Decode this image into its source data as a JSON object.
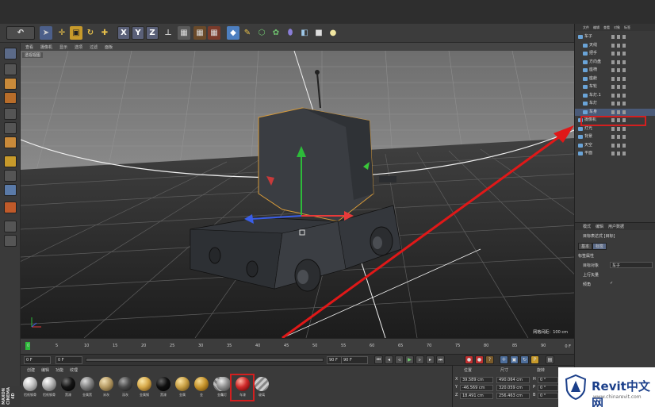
{
  "viewport": {
    "menu": [
      "查看",
      "摄像机",
      "显示",
      "选项",
      "过滤",
      "面板"
    ],
    "title": "透视视图",
    "grid_scale": "网格间距：100 cm"
  },
  "timeline": {
    "ticks": [
      "0",
      "5",
      "10",
      "15",
      "20",
      "25",
      "30",
      "35",
      "40",
      "45",
      "50",
      "55",
      "60",
      "65",
      "70",
      "75",
      "80",
      "85",
      "90"
    ],
    "frame_end": "0 F"
  },
  "playbar": {
    "start_field": "0 F",
    "current_field": "0 F",
    "end_field": "90 F",
    "end_field2": "90 F"
  },
  "materials": {
    "menu": [
      "创建",
      "编辑",
      "功能",
      "纹理"
    ],
    "items": [
      {
        "name": "铝纸钢骨",
        "color": "#c8c8c8"
      },
      {
        "name": "铝纸钢骨",
        "color": "#b9b9b9"
      },
      {
        "name": "黑漆",
        "color": "#141414"
      },
      {
        "name": "金属黑",
        "color": "#8a8a8a"
      },
      {
        "name": "米灰",
        "color": "#b59a64"
      },
      {
        "name": "深灰",
        "color": "#4a4a4a"
      },
      {
        "name": "金属钢",
        "color": "#d7a94a"
      },
      {
        "name": "黑漆",
        "color": "#0f0f0f"
      },
      {
        "name": "金属",
        "color": "#c9a045"
      },
      {
        "name": "金",
        "color": "#c7952d"
      },
      {
        "name": "金属",
        "color": "#9b9b9b"
      },
      {
        "name": "车灯",
        "color": "#8e8e8e"
      },
      {
        "name": "车漆",
        "color": "#d02a2a"
      },
      {
        "name": "玻璃",
        "color": "#9a9a9a"
      }
    ]
  },
  "coords": {
    "headers": [
      "位置",
      "尺寸",
      "旋转"
    ],
    "rows": [
      {
        "axis": "X",
        "pos": "39.589 cm",
        "size": "490.064 cm",
        "rot_label": "H",
        "rot": "0 °"
      },
      {
        "axis": "Y",
        "pos": "-46.569 cm",
        "size": "320.059 cm",
        "rot_label": "P",
        "rot": "0 °"
      },
      {
        "axis": "Z",
        "pos": "18.491 cm",
        "size": "256.463 cm",
        "rot_label": "B",
        "rot": "0 °"
      }
    ]
  },
  "object_manager": {
    "menu": [
      "文件",
      "编辑",
      "查看",
      "对象",
      "标签"
    ],
    "objects": [
      {
        "name": "车子",
        "indent": 0
      },
      {
        "name": "天线",
        "indent": 1
      },
      {
        "name": "把手",
        "indent": 1
      },
      {
        "name": "方向盘",
        "indent": 1
      },
      {
        "name": "座椅",
        "indent": 1
      },
      {
        "name": "座舱",
        "indent": 1
      },
      {
        "name": "车轮",
        "indent": 1
      },
      {
        "name": "车灯.1",
        "indent": 1
      },
      {
        "name": "车灯",
        "indent": 1
      },
      {
        "name": "车身",
        "indent": 1
      },
      {
        "name": "摄像机",
        "indent": 0
      },
      {
        "name": "灯光",
        "indent": 0
      },
      {
        "name": "背景",
        "indent": 0
      },
      {
        "name": "天空",
        "indent": 0
      },
      {
        "name": "平面",
        "indent": 0
      }
    ],
    "selected": "车身"
  },
  "attribute_manager": {
    "menu": [
      "模式",
      "编辑",
      "用户数据"
    ],
    "title": "目标表达式 [目标]",
    "tabs": [
      "基本",
      "标签"
    ],
    "section": "标签属性",
    "target_label": "目标对象",
    "target_value": "车子",
    "up_label": "上行矢量",
    "bank_label": "倾角",
    "bank_check": "✓"
  },
  "branding": {
    "logo_text": "Revit中文网",
    "logo_url": "www.chinarevit.com",
    "maxon": "MAXON CINEMA 4D"
  },
  "colors": {
    "highlight": "#d41f1f",
    "arrow": "#e01818",
    "accent": "#6aa4d8"
  }
}
